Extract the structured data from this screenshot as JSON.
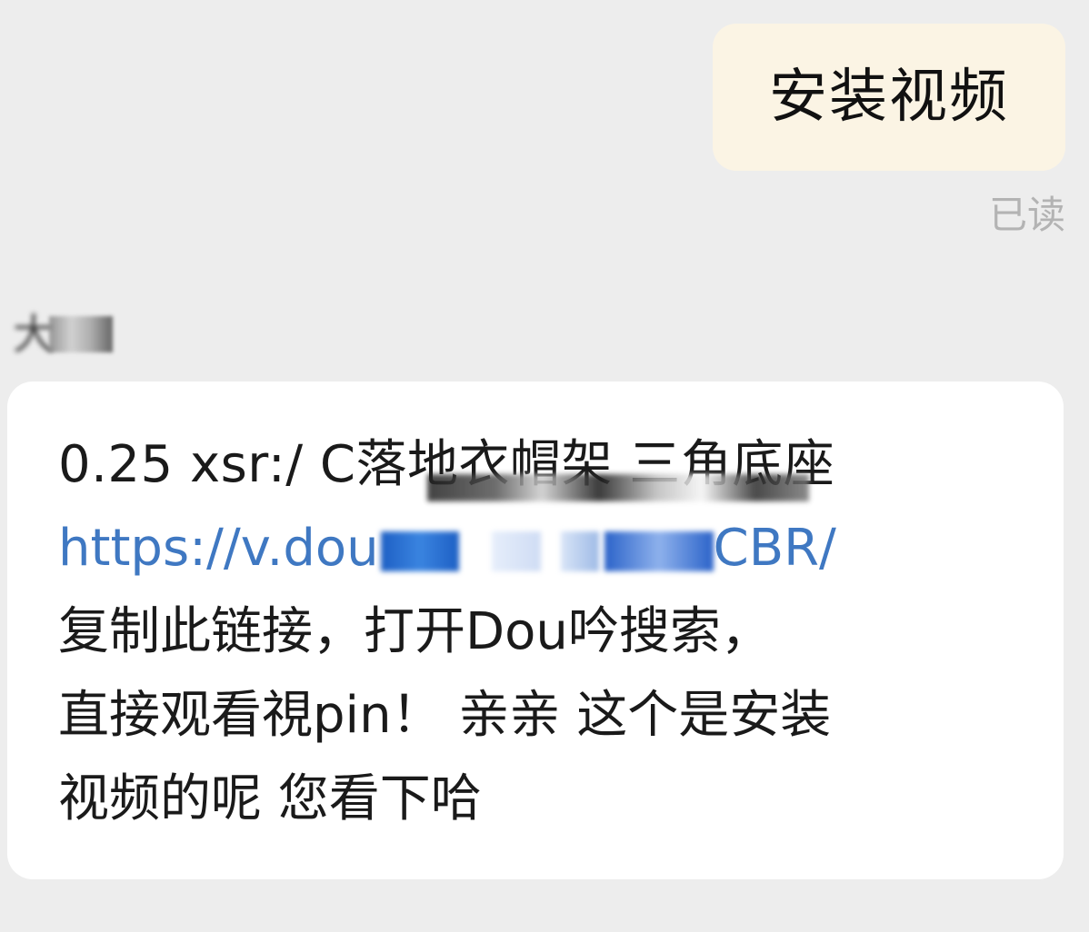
{
  "outgoing": {
    "text": "安装视频",
    "status": "已读"
  },
  "incoming": {
    "sender_visible": "大",
    "line1": "0.25 xsr:/ C落地衣帽架  三角底座",
    "link_start": "https://v.dou",
    "link_end": "CBR/",
    "line3": "复制此链接，打开Dou吟搜索，",
    "line4": "直接观看視pin！  亲亲 这个是安装",
    "line5": "视频的呢 您看下哈"
  },
  "colors": {
    "background": "#ededed",
    "outgoing_bubble": "#fbf4e4",
    "incoming_bubble": "#ffffff",
    "link": "#3f78c2",
    "status_text": "#b3b3b3"
  }
}
